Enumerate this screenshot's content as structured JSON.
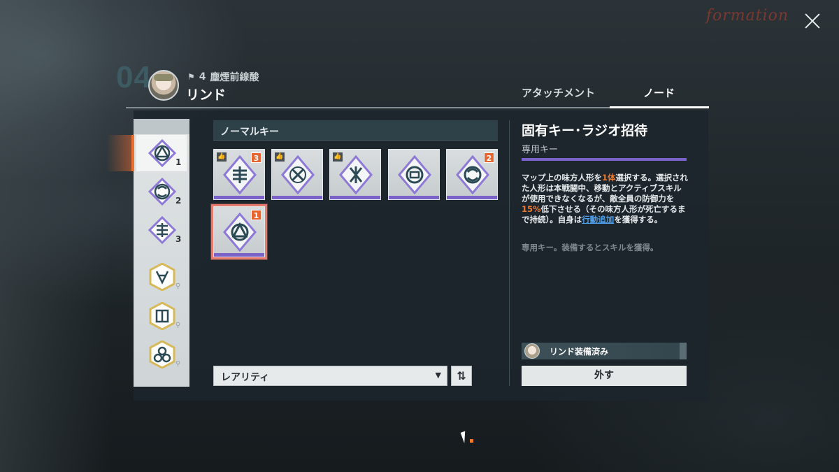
{
  "header": {
    "slot_number": "04",
    "echelon_number": "4",
    "squad_name": "塵煙前線酸",
    "character_name": "リンド",
    "logo_text": "formation"
  },
  "tabs": [
    {
      "label": "アタッチメント",
      "active": false
    },
    {
      "label": "ノード",
      "active": true
    }
  ],
  "rail": {
    "items": [
      {
        "number": "1",
        "icon": "node-key-icon",
        "active": true
      },
      {
        "number": "2",
        "icon": "node-key-icon",
        "active": false
      },
      {
        "number": "3",
        "icon": "node-key-icon",
        "active": false
      },
      {
        "number": "",
        "icon": "gold-key-icon",
        "locked": true
      },
      {
        "number": "",
        "icon": "gold-key-icon",
        "locked": true
      },
      {
        "number": "",
        "icon": "gold-key-icon",
        "locked": true
      }
    ]
  },
  "keys_section": {
    "title": "ノーマルキー",
    "cards": [
      {
        "recommended": true,
        "count": "3",
        "selected": false
      },
      {
        "recommended": true,
        "count": "",
        "selected": false
      },
      {
        "recommended": true,
        "count": "",
        "selected": false
      },
      {
        "recommended": false,
        "count": "",
        "selected": false
      },
      {
        "recommended": false,
        "count": "2",
        "selected": false
      },
      {
        "recommended": false,
        "count": "1",
        "selected": true
      }
    ]
  },
  "sort": {
    "selected": "レアリティ",
    "order_icon": "sort-order-icon"
  },
  "detail": {
    "title": "固有キー･ラジオ招待",
    "subtitle": "専用キー",
    "desc_1": "マップ上の味方人形を",
    "desc_hl_1": "1体",
    "desc_2": "選択する。選択された人形は本戦闘中、移動とアクティブスキルが使用できなくなるが、敵全員の防御力を",
    "desc_hl_2": "15%",
    "desc_3": "低下させる（その味方人形が死亡するまで持続）。自身は",
    "desc_link": "行動追加",
    "desc_4": "を獲得する。",
    "note": "専用キー。装備するとスキルを獲得。",
    "equipped_label": "リンド装備済み",
    "unequip_button": "外す"
  },
  "colors": {
    "accent_orange": "#e9702f",
    "rarity_purple": "#7a62c9",
    "selected_outline": "#e57a6f",
    "link_blue": "#4fa3f0"
  }
}
